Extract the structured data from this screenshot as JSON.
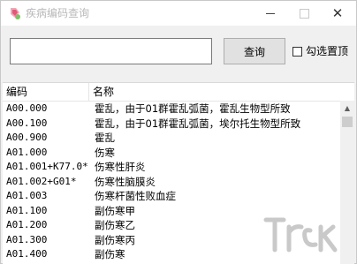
{
  "window": {
    "title": "疾病编码查询",
    "close_glyph": "✕"
  },
  "search": {
    "value": "",
    "placeholder": "",
    "button_label": "查询",
    "pin_label": "勾选置顶",
    "pin_checked": false
  },
  "table": {
    "columns": [
      "编码",
      "名称"
    ],
    "rows": [
      {
        "code": "A00.000",
        "name": "霍乱，由于01群霍乱弧菌，霍乱生物型所致"
      },
      {
        "code": "A00.100",
        "name": "霍乱，由于01群霍乱弧菌，埃尔托生物型所致"
      },
      {
        "code": "A00.900",
        "name": "霍乱"
      },
      {
        "code": "A01.000",
        "name": "伤寒"
      },
      {
        "code": "A01.001+K77.0*",
        "name": "伤寒性肝炎"
      },
      {
        "code": "A01.002+G01*",
        "name": "伤寒性脑膜炎"
      },
      {
        "code": "A01.003",
        "name": "伤寒杆菌性败血症"
      },
      {
        "code": "A01.100",
        "name": "副伤寒甲"
      },
      {
        "code": "A01.200",
        "name": "副伤寒乙"
      },
      {
        "code": "A01.300",
        "name": "副伤寒丙"
      },
      {
        "code": "A01.400",
        "name": "副伤寒"
      }
    ]
  },
  "colors": {
    "title_text": "#b8b8b8",
    "window_bg": "#f0f0f0",
    "list_bg": "#ffffff"
  }
}
